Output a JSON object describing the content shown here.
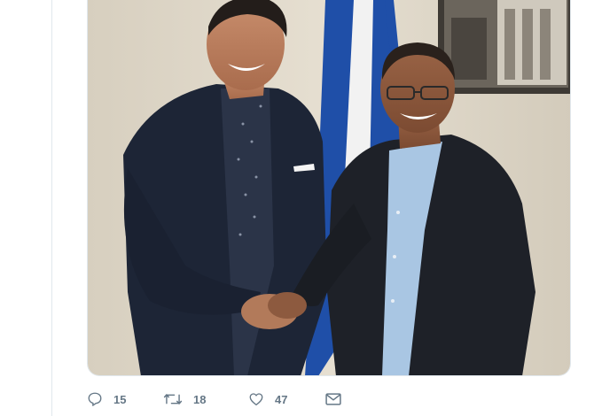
{
  "tweet": {
    "photo": {
      "alt": ""
    },
    "actions": {
      "reply": {
        "icon": "reply-icon",
        "count": "15"
      },
      "retweet": {
        "icon": "retweet-icon",
        "count": "18"
      },
      "like": {
        "icon": "heart-icon",
        "count": "47"
      },
      "message": {
        "icon": "envelope-icon"
      }
    }
  },
  "colors": {
    "icon_gray": "#657786",
    "border": "#e1e8ed",
    "flag_blue": "#1f4fa8",
    "wall": "#ddd6c7"
  }
}
